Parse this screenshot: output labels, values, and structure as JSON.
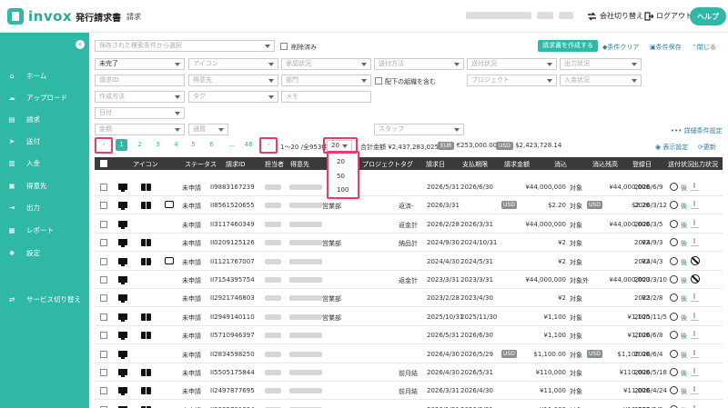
{
  "header": {
    "logo_text": "invox",
    "logo_sub": "発行請求書",
    "breadcrumb": "請求",
    "switch_company": "会社切り替え",
    "logout": "ログアウト",
    "help": "ヘルプ"
  },
  "sidebar": {
    "items": [
      {
        "label": "ホーム",
        "icon": "home-icon"
      },
      {
        "label": "アップロード",
        "icon": "upload-icon"
      },
      {
        "label": "請求",
        "icon": "invoice-icon"
      },
      {
        "label": "送付",
        "icon": "send-icon"
      },
      {
        "label": "入金",
        "icon": "bank-icon"
      },
      {
        "label": "得意先",
        "icon": "client-icon"
      },
      {
        "label": "出力",
        "icon": "export-icon"
      },
      {
        "label": "レポート",
        "icon": "report-icon"
      },
      {
        "label": "設定",
        "icon": "settings-icon"
      },
      {
        "label": "サービス切り替え",
        "icon": "switch-icon"
      }
    ]
  },
  "filters": {
    "saved_search_placeholder": "保存された検索条件から選択",
    "deleted_label": "削除済み",
    "create_invoice": "請求書を作成する",
    "clear_conditions": "条件クリア",
    "save_conditions": "条件保存",
    "close": "閉じる",
    "status_value": "未完了",
    "icon_ph": "アイコン",
    "approval_ph": "承認状況",
    "send_method_ph": "送付方法",
    "send_status_ph": "送付状況",
    "output_status_ph": "出力状況",
    "invoice_id_ph": "請求ID",
    "client_ph": "得意先",
    "department_ph": "部門",
    "include_sub_label": "配下の組織を含む",
    "project_ph": "プロジェクト",
    "payment_status_ph": "入金状況",
    "creation_method_ph": "作成方法",
    "tag_ph": "タグ",
    "memo_ph": "メモ",
    "date_ph": "日付",
    "amount_ph": "金額",
    "currency_ph": "通貨",
    "staff_ph": "スタッフ",
    "detail_settings": "詳細条件設定"
  },
  "pagination": {
    "pages": [
      "1",
      "2",
      "3",
      "4",
      "5",
      "6",
      "...",
      "48"
    ],
    "range_text": "1〜20 /全953件",
    "page_size": "20",
    "page_size_options": [
      "20",
      "50",
      "100"
    ],
    "total_label": "合計金額",
    "total_jpy": "¥2,437,283,025",
    "eur_badge": "EUR",
    "total_eur": "€253,000.00",
    "usd_badge": "USD",
    "total_usd": "$2,423,728.14",
    "display_settings": "表示設定",
    "refresh": "更新"
  },
  "table": {
    "columns": [
      "アイコン",
      "ステータス",
      "請求ID",
      "担当者",
      "得意先",
      "プロジェクトタグ",
      "請求日",
      "支払期限",
      "請求金額",
      "消込",
      "消込残高",
      "登録日",
      "送付状況",
      "出力状況"
    ],
    "rows": [
      {
        "id": "II9883167239",
        "status": "未申請",
        "dept": "",
        "proj": "",
        "issue": "2026/5/31",
        "due": "2026/6/30",
        "amount": "¥44,000,000",
        "usd": false,
        "recon": "対象",
        "remaining": "¥44,000,000",
        "remaining_usd": false,
        "reg": "2026/6/9",
        "send": "後",
        "book": true,
        "msg": false,
        "ban": false
      },
      {
        "id": "II8561520655",
        "status": "未申請",
        "dept": "営業部",
        "proj": "返済-",
        "issue": "2026/3/31",
        "due": "",
        "amount": "$2.20",
        "usd": true,
        "recon": "対象",
        "remaining": "$2.20",
        "remaining_usd": true,
        "reg": "2026/3/12",
        "send": "後",
        "book": true,
        "msg": true,
        "ban": false
      },
      {
        "id": "II3117460349",
        "status": "未申請",
        "dept": "",
        "proj": "返金計",
        "issue": "2026/2/28",
        "due": "2026/3/31",
        "amount": "¥44,000,000",
        "usd": false,
        "recon": "対象",
        "remaining": "¥44,000,000",
        "remaining_usd": false,
        "reg": "2026/3/5",
        "send": "後",
        "book": false,
        "msg": false,
        "ban": false
      },
      {
        "id": "II0209125126",
        "status": "未申請",
        "dept": "営業部",
        "proj": "納品計",
        "issue": "2024/9/30",
        "due": "2024/10/31",
        "amount": "¥2",
        "usd": false,
        "recon": "対象",
        "remaining": "¥2",
        "remaining_usd": false,
        "reg": "2024/9/3",
        "send": "後",
        "book": true,
        "msg": false,
        "ban": false
      },
      {
        "id": "II1121767007",
        "status": "未申請",
        "dept": "",
        "proj": "",
        "issue": "2024/4/30",
        "due": "2024/5/31",
        "amount": "¥2",
        "usd": false,
        "recon": "対象",
        "remaining": "¥2",
        "remaining_usd": false,
        "reg": "2024/4/3",
        "send": "後",
        "book": true,
        "msg": true,
        "ban": true
      },
      {
        "id": "II7154395754",
        "status": "未申請",
        "dept": "",
        "proj": "返金計",
        "issue": "2023/3/31",
        "due": "2023/3/31",
        "amount": "¥44,000,000",
        "usd": false,
        "recon": "対象外",
        "remaining": "¥44,000,000",
        "remaining_usd": false,
        "reg": "2023/3/10",
        "send": "後",
        "book": false,
        "msg": false,
        "ban": true
      },
      {
        "id": "II2921746803",
        "status": "未申請",
        "dept": "営業部",
        "proj": "",
        "issue": "2023/2/28",
        "due": "2023/4/30",
        "amount": "¥2",
        "usd": false,
        "recon": "対象",
        "remaining": "¥2",
        "remaining_usd": false,
        "reg": "2023/2/8",
        "send": "後",
        "book": false,
        "msg": false,
        "ban": false
      },
      {
        "id": "II2949140110",
        "status": "未申請",
        "dept": "営業部",
        "proj": "",
        "issue": "2025/10/31",
        "due": "2025/11/30",
        "amount": "¥1,100",
        "usd": false,
        "recon": "対象",
        "remaining": "¥1,100",
        "remaining_usd": false,
        "reg": "2025/11/5",
        "send": "後",
        "book": true,
        "msg": false,
        "ban": false
      },
      {
        "id": "II5710946397",
        "status": "未申請",
        "dept": "",
        "proj": "",
        "issue": "2026/5/31",
        "due": "2026/6/30",
        "amount": "¥1,100",
        "usd": false,
        "recon": "対象",
        "remaining": "¥1,100",
        "remaining_usd": false,
        "reg": "2026/6/8",
        "send": "後",
        "book": true,
        "msg": false,
        "ban": false
      },
      {
        "id": "II2834598250",
        "status": "未申請",
        "dept": "",
        "proj": "",
        "issue": "2026/4/30",
        "due": "2026/5/29",
        "amount": "$1,100.00",
        "usd": true,
        "recon": "対象",
        "remaining": "$1,100.00",
        "remaining_usd": true,
        "reg": "2026/6/4",
        "send": "後",
        "book": false,
        "msg": false,
        "ban": false
      },
      {
        "id": "II5505175844",
        "status": "未申請",
        "dept": "",
        "proj": "前月結",
        "issue": "2026/4/30",
        "due": "2026/5/31",
        "amount": "¥110,000",
        "usd": false,
        "recon": "対象",
        "remaining": "¥110,000",
        "remaining_usd": false,
        "reg": "2026/5/18",
        "send": "後",
        "book": true,
        "msg": false,
        "ban": false
      },
      {
        "id": "II2497877695",
        "status": "未申請",
        "dept": "",
        "proj": "前月結",
        "issue": "2026/3/31",
        "due": "2026/4/30",
        "amount": "¥11,000",
        "usd": false,
        "recon": "対象",
        "remaining": "¥11,000",
        "remaining_usd": false,
        "reg": "2026/4/24",
        "send": "後",
        "book": true,
        "msg": false,
        "ban": false
      },
      {
        "id": "II9385701834",
        "status": "未申請",
        "dept": "",
        "proj": "",
        "issue": "2026/1/31",
        "due": "2026/3/31",
        "amount": "¥11,000",
        "usd": false,
        "recon": "対象",
        "remaining": "¥11,000",
        "remaining_usd": false,
        "reg": "2026/2/9",
        "send": "後",
        "book": true,
        "msg": false,
        "ban": false
      }
    ]
  }
}
